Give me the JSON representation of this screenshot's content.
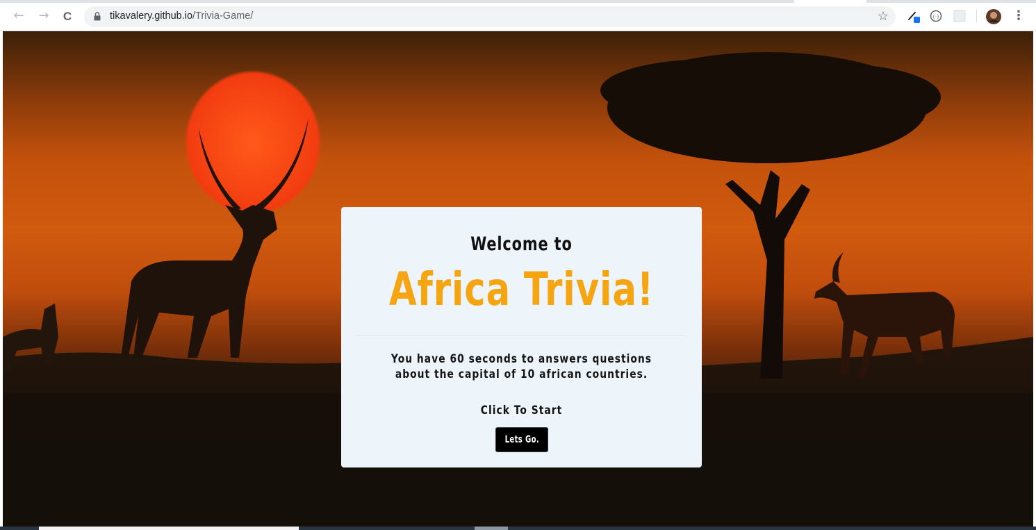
{
  "browser": {
    "url_host": "tikavalery.github.io",
    "url_path": "/Trivia-Game/",
    "back_icon": "←",
    "forward_icon": "→",
    "reload_icon": "C",
    "bookmark_icon": "☆",
    "menu_icon": "⋮"
  },
  "card": {
    "welcome": "Welcome to",
    "title": "Africa Trivia!",
    "description": "You have 60 seconds to answers questions about the capital of 10 african countries.",
    "cta": "Click To Start",
    "button_label": "Lets Go."
  },
  "colors": {
    "title": "#f6a512",
    "card_bg": "#edf5fb",
    "button_bg": "#000000"
  }
}
